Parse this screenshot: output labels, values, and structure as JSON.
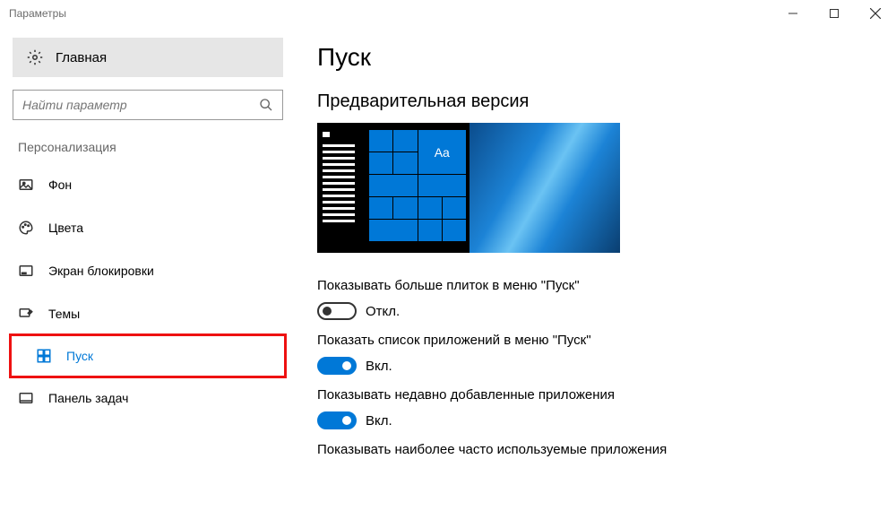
{
  "window": {
    "title": "Параметры"
  },
  "sidebar": {
    "home": "Главная",
    "search_placeholder": "Найти параметр",
    "group": "Персонализация",
    "items": [
      {
        "label": "Фон"
      },
      {
        "label": "Цвета"
      },
      {
        "label": "Экран блокировки"
      },
      {
        "label": "Темы"
      },
      {
        "label": "Пуск"
      },
      {
        "label": "Панель задач"
      }
    ]
  },
  "main": {
    "title": "Пуск",
    "subtitle": "Предварительная версия",
    "preview_tile_text": "Aa",
    "settings": [
      {
        "label": "Показывать больше плиток в меню \"Пуск\"",
        "state": "Откл.",
        "on": false
      },
      {
        "label": "Показать список приложений в меню \"Пуск\"",
        "state": "Вкл.",
        "on": true
      },
      {
        "label": "Показывать недавно добавленные приложения",
        "state": "Вкл.",
        "on": true
      },
      {
        "label": "Показывать наиболее часто используемые приложения",
        "state": "",
        "on": true
      }
    ]
  }
}
